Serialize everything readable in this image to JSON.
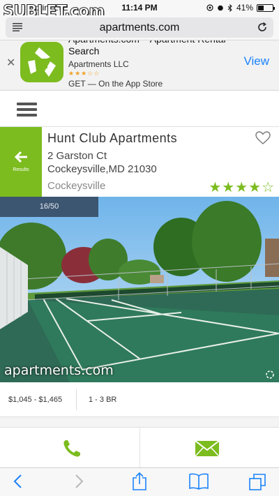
{
  "status_bar": {
    "carrier": "Sprint   LTE",
    "time": "11:14 PM",
    "battery": "41%",
    "battery_level": 0.41,
    "watermark": "SUBLET.com"
  },
  "browser": {
    "url": "apartments.com"
  },
  "app_banner": {
    "title": "Apartments.com – Apartment Rental Search",
    "developer": "Apartments LLC",
    "rating_stars": "★★★☆☆",
    "cta_line": "GET — On the App Store",
    "view_label": "View",
    "close_label": "✕"
  },
  "listing": {
    "back_label": "Results",
    "name": "Hunt Club Apartments",
    "address_line1": "2 Garston Ct",
    "address_line2": "Cockeysville,MD 21030",
    "neighborhood": "Cockeysville",
    "rating": 4,
    "rating_max": 5
  },
  "gallery": {
    "counter": "16/50",
    "photo_watermark": "apartments.com"
  },
  "summary": {
    "price": "$1,045 - $1,465",
    "beds": "1 - 3 BR"
  },
  "colors": {
    "brand_green": "#7cbc1f",
    "link_blue": "#1a82fb",
    "counter_bg": "#3c5570"
  }
}
